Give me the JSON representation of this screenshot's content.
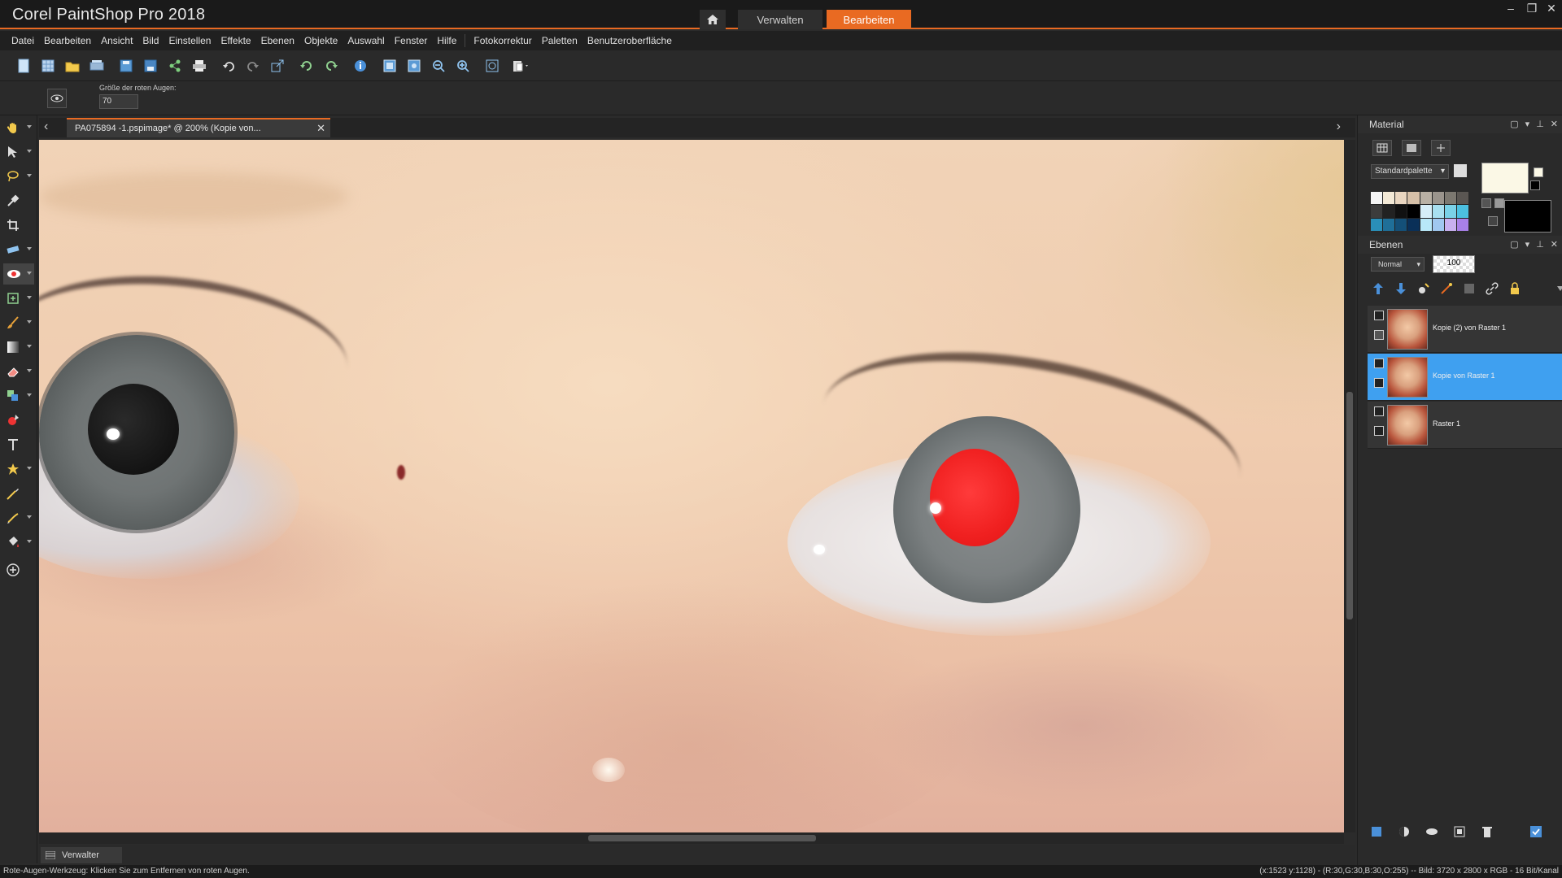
{
  "app": {
    "title": "Corel PaintShop Pro 2018",
    "workspace_tabs": [
      {
        "label": "Verwalten",
        "active": false
      },
      {
        "label": "Bearbeiten",
        "active": true
      }
    ],
    "accent_color": "#e96a22"
  },
  "menu": {
    "items": [
      "Datei",
      "Bearbeiten",
      "Ansicht",
      "Bild",
      "Einstellen",
      "Effekte",
      "Ebenen",
      "Objekte",
      "Auswahl",
      "Fenster",
      "Hilfe",
      "Fotokorrektur",
      "Paletten",
      "Benutzeroberfläche"
    ]
  },
  "toolbar": {
    "icons": [
      "new-file-icon",
      "new-from-template-icon",
      "open-icon",
      "scan-icon",
      "save-icon",
      "save-as-icon",
      "share-icon",
      "print-icon",
      "undo-icon",
      "redo-icon",
      "resize-icon",
      "rotate-left-icon",
      "rotate-right-icon",
      "info-icon",
      "fit-window-icon",
      "actual-size-icon",
      "zoom-out-icon",
      "zoom-in-icon",
      "fit-image-icon",
      "paste-icon"
    ]
  },
  "tool_options": {
    "label": "Größe der roten Augen:",
    "value": "70"
  },
  "document": {
    "tab_title": "PA075894 -1.pspimage* @ 200% (Kopie von..."
  },
  "tools": [
    "pan-tool-icon",
    "pick-tool-icon",
    "lasso-tool-icon",
    "dropper-tool-icon",
    "crop-tool-icon",
    "straighten-tool-icon",
    "red-eye-tool-icon",
    "makeover-tool-icon",
    "paint-brush-icon",
    "gradient-tool-icon",
    "eraser-tool-icon",
    "clone-tool-icon",
    "color-replacer-icon",
    "text-tool-icon",
    "preset-shape-icon",
    "pen-tool-icon",
    "smudge-tool-icon",
    "fill-tool-icon",
    "add-tool-icon"
  ],
  "organizer": {
    "label": "Verwalter"
  },
  "status": {
    "left": "Rote-Augen-Werkzeug: Klicken Sie zum Entfernen von roten Augen.",
    "right": "(x:1523 y:1128) - (R:30,G:30,B:30,O:255) -- Bild:  3720 x 2800 x RGB - 16 Bit/Kanal"
  },
  "material_panel": {
    "title": "Material",
    "palette_select": "Standardpalette",
    "foreground_color": "#fbf8e6",
    "background_color": "#000000"
  },
  "layers_panel": {
    "title": "Ebenen",
    "blend_mode": "Normal",
    "opacity": "100",
    "layers": [
      {
        "name": "Kopie (2) von Raster 1",
        "selected": false
      },
      {
        "name": "Kopie von Raster 1",
        "selected": true
      },
      {
        "name": "Raster 1",
        "selected": false
      }
    ]
  }
}
